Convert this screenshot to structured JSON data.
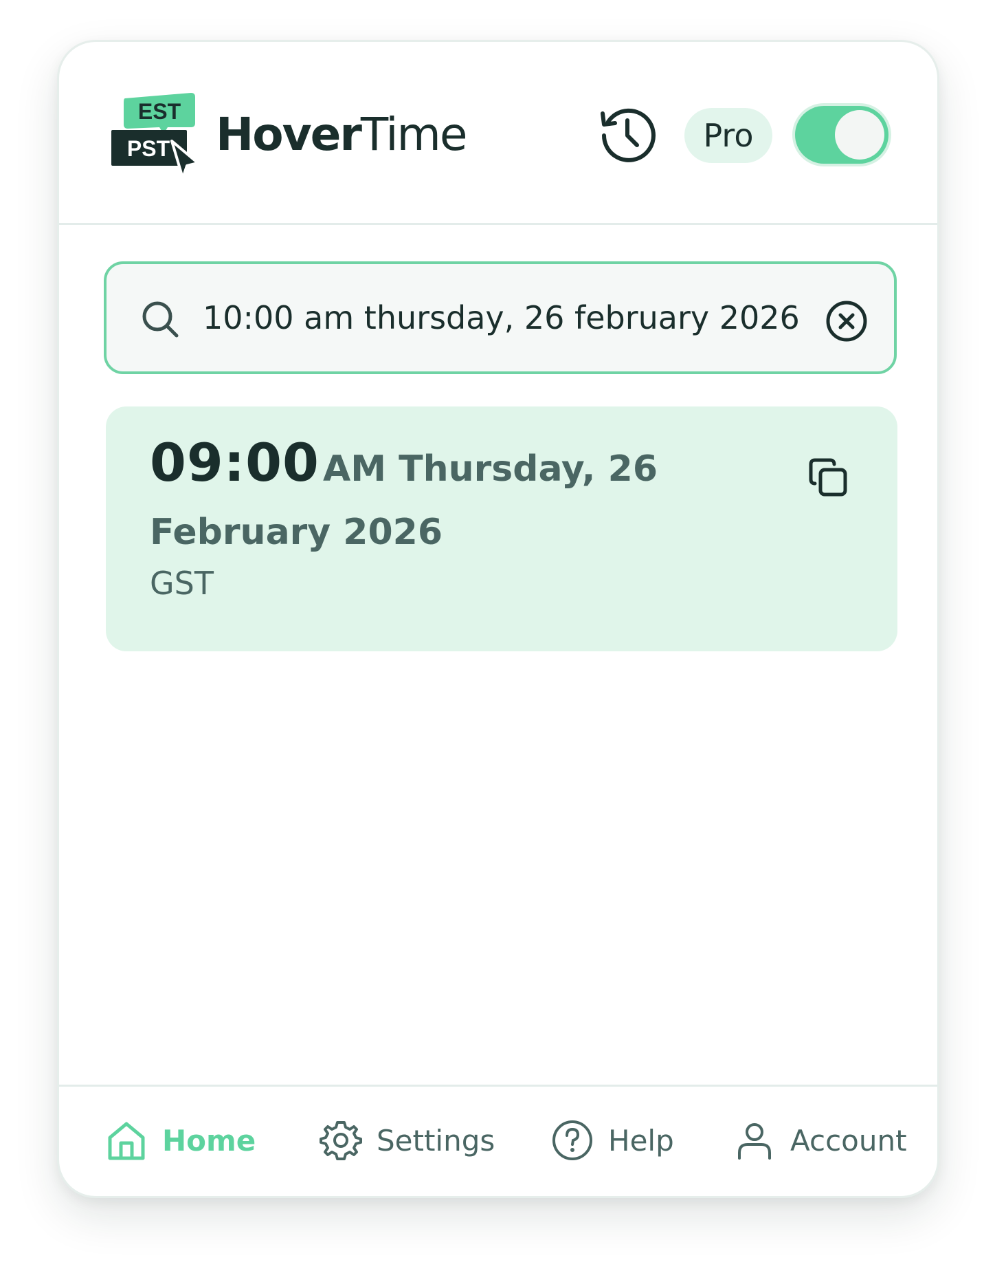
{
  "app": {
    "logo_tags": {
      "top": "EST",
      "bottom": "PST"
    },
    "name_bold": "Hover",
    "name_light": "Time",
    "pro_label": "Pro",
    "toggle_state": "on"
  },
  "search": {
    "value": "10:00 am thursday, 26 february 2026 (",
    "placeholder": ""
  },
  "result": {
    "time": "09:00",
    "date_text": "AM Thursday, 26 February 2026",
    "timezone": "GST"
  },
  "nav": {
    "items": [
      {
        "label": "Home",
        "icon": "home-icon",
        "active": true
      },
      {
        "label": "Settings",
        "icon": "gear-icon",
        "active": false
      },
      {
        "label": "Help",
        "icon": "help-icon",
        "active": false
      },
      {
        "label": "Account",
        "icon": "user-icon",
        "active": false
      }
    ]
  },
  "colors": {
    "accent": "#5dd39e",
    "accent_light": "#e0f5ea",
    "text_dark": "#1a2e2c",
    "text_muted": "#4a6663"
  }
}
